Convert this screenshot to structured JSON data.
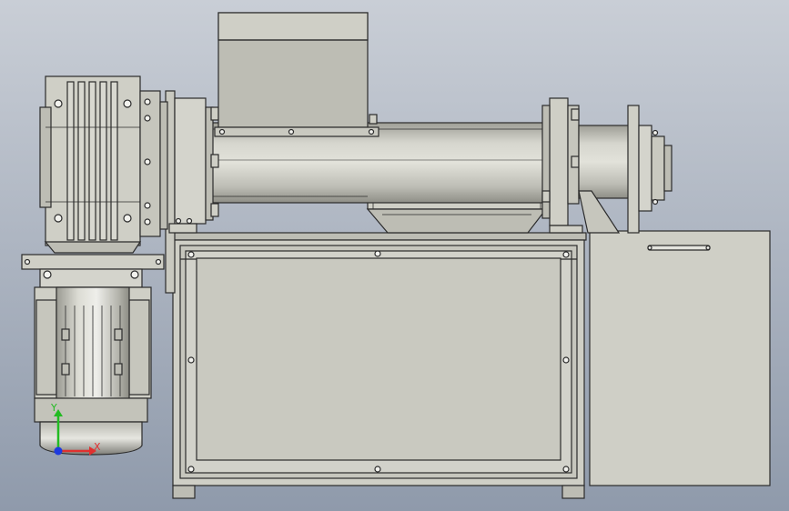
{
  "viewport": {
    "background_top": "#c9ced6",
    "background_bottom": "#8f9aab"
  },
  "model": {
    "colors": {
      "body": "#cfcfc6",
      "body_light": "#dcdcd4",
      "body_dark": "#a9a9a0",
      "panel": "#c3c3ba",
      "outline": "#2b2b2b",
      "bolt": "#f2f2ee"
    }
  },
  "triad": {
    "x_label": "X",
    "y_label": "Y",
    "x_color": "#e03030",
    "y_color": "#22bb22",
    "z_color": "#1e3adf"
  }
}
